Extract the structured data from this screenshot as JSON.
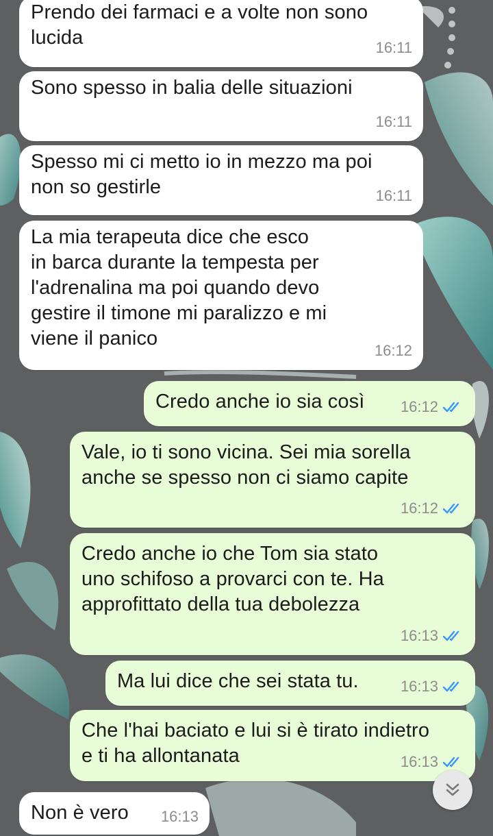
{
  "messages": [
    {
      "id": "m1",
      "dir": "in",
      "text": "Prendo dei farmaci e a volte non sono\nlucida",
      "time": "16:11"
    },
    {
      "id": "m2",
      "dir": "in",
      "text": "Sono spesso in balia delle situazioni",
      "time": "16:11"
    },
    {
      "id": "m3",
      "dir": "in",
      "text": "Spesso mi ci metto io in mezzo ma poi\nnon so gestirle",
      "time": "16:11"
    },
    {
      "id": "m4",
      "dir": "in",
      "text": "La mia terapeuta dice che esco\nin barca durante la tempesta per\nl'adrenalina ma poi quando devo\ngestire il timone mi paralizzo e mi\nviene il panico",
      "time": "16:12"
    },
    {
      "id": "m5",
      "dir": "out",
      "text": "Credo anche io sia così",
      "time": "16:12",
      "status": "read"
    },
    {
      "id": "m6",
      "dir": "out",
      "text": "Vale, io ti sono vicina. Sei mia sorella\nanche se spesso non ci siamo capite",
      "time": "16:12",
      "status": "read"
    },
    {
      "id": "m7",
      "dir": "out",
      "text": "Credo anche io che Tom sia stato\nuno schifoso a provarci con te. Ha\napprofittato della tua debolezza",
      "time": "16:13",
      "status": "read"
    },
    {
      "id": "m8",
      "dir": "out",
      "text": "Ma lui dice che sei stata tu.",
      "time": "16:13",
      "status": "read"
    },
    {
      "id": "m9",
      "dir": "out",
      "text": "Che l'hai baciato e lui si è tirato indietro\ne ti ha allontanata",
      "time": "16:13",
      "status": "read"
    },
    {
      "id": "m10",
      "dir": "in",
      "text": "Non è vero",
      "time": "16:13"
    }
  ],
  "scroll_button": {
    "icon": "double-chevron-down-icon"
  },
  "colors": {
    "incoming_bubble": "#ffffff",
    "outgoing_bubble": "#e9fcd8",
    "read_ticks": "#3497f9",
    "timestamp": "#8c8c8c",
    "wallpaper_base": "#5d5f61",
    "wallpaper_leaf": "#6fb9b4"
  }
}
